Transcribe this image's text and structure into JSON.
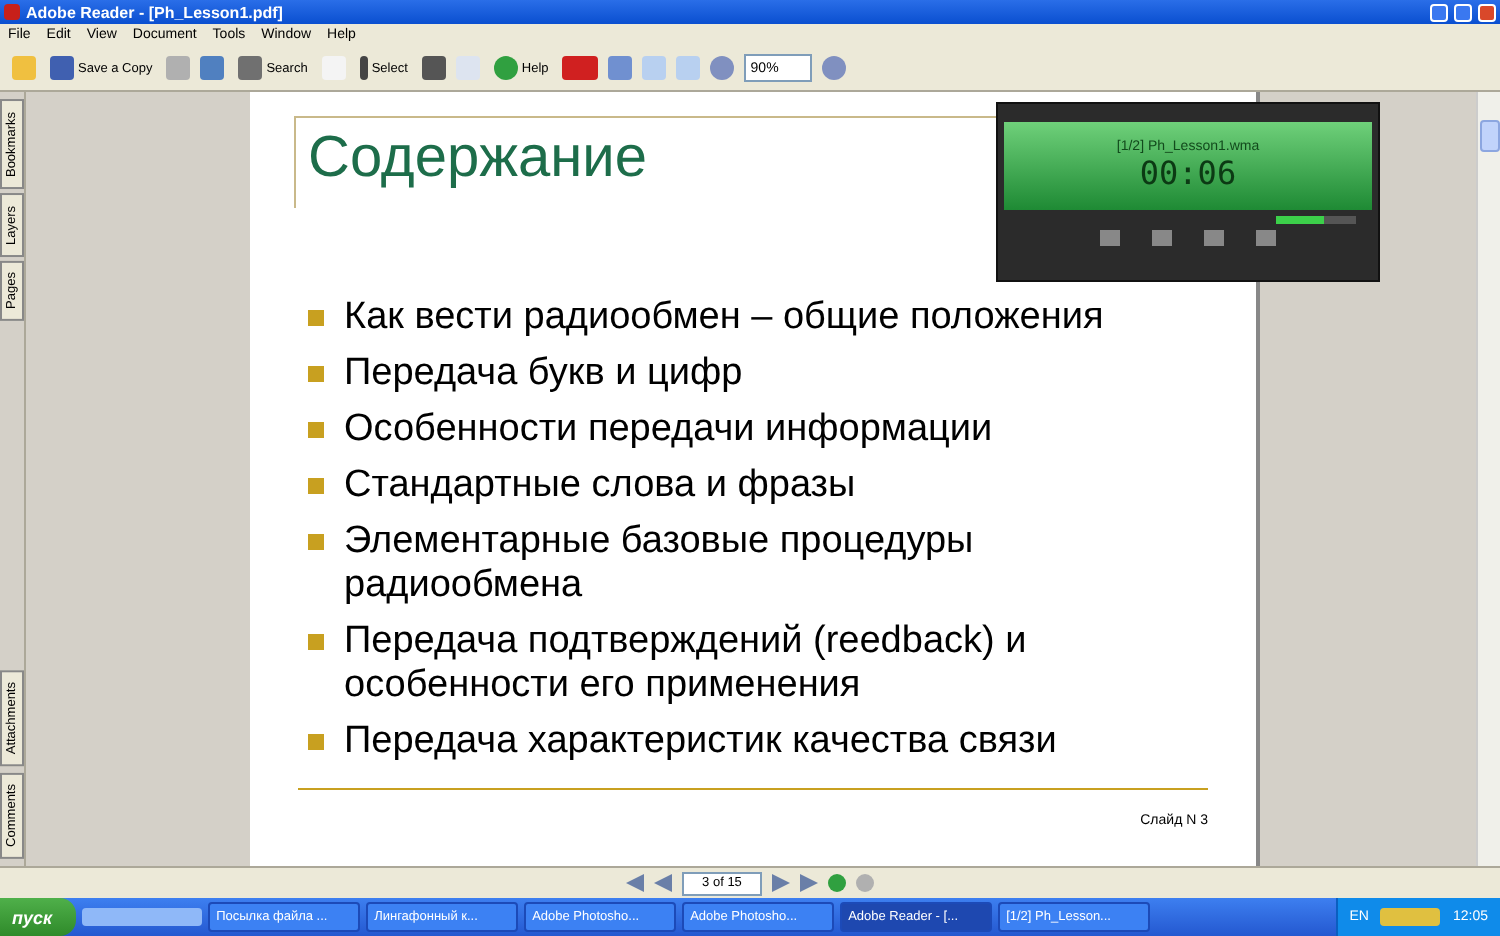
{
  "window": {
    "title": "Adobe Reader - [Ph_Lesson1.pdf]"
  },
  "menu": [
    "File",
    "Edit",
    "View",
    "Document",
    "Tools",
    "Window",
    "Help"
  ],
  "toolbar": {
    "save_copy": "Save a Copy",
    "search": "Search",
    "select": "Select",
    "help": "Help",
    "zoom": "90%"
  },
  "side_tabs": [
    {
      "label": "Bookmarks",
      "selected": false
    },
    {
      "label": "Layers",
      "selected": false
    },
    {
      "label": "Pages",
      "selected": false
    }
  ],
  "side_tabs_bottom": [
    {
      "label": "Attachments",
      "selected": false
    },
    {
      "label": "Comments",
      "selected": false
    }
  ],
  "slide": {
    "title": "Содержание",
    "items": [
      "Как вести радиообмен – общие положения",
      "Передача букв и цифр",
      "Особенности передачи информации",
      "Стандартные слова и фразы",
      "Элементарные базовые процедуры радиообмена",
      "Передача подтверждений (reedback) и особенности его применения",
      "Передача характеристик качества связи"
    ],
    "footer": "Слайд N 3"
  },
  "player": {
    "track": "[1/2] Ph_Lesson1.wma",
    "time": "00:06",
    "volume": {
      "level": 0.6
    }
  },
  "navigation": {
    "page": "3 of 15"
  },
  "taskbar": {
    "start": "пуск",
    "tasks": [
      {
        "label": "Посылка файла ...",
        "selected": false
      },
      {
        "label": "Лингафонный к...",
        "selected": false
      },
      {
        "label": "Adobe Photosho...",
        "selected": false
      },
      {
        "label": "Adobe Photosho...",
        "selected": false
      },
      {
        "label": "Adobe Reader - [...",
        "selected": true
      },
      {
        "label": "[1/2] Ph_Lesson...",
        "selected": false
      }
    ],
    "language": "EN",
    "clock": "12:05"
  }
}
